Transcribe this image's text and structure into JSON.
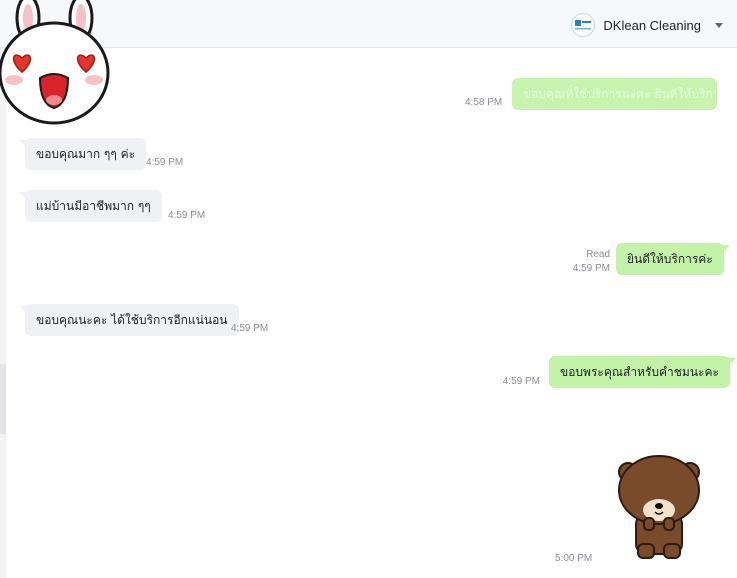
{
  "header": {
    "account_name": "DKlean Cleaning"
  },
  "messages": [
    {
      "side": "out",
      "text": "ขอบคุณที่ใช้บริการนะคะ ยินดีให้บริการค่ะ",
      "time": "4:58 PM"
    },
    {
      "side": "in",
      "text": "ขอบคุณมาก ๆๆ ค่ะ",
      "time": "4:59 PM"
    },
    {
      "side": "in",
      "text": "แม่บ้านมีอาชีพมาก ๆๆ",
      "time": "4:59 PM"
    },
    {
      "side": "out",
      "text": "ยินดีให้บริการค่ะ",
      "time": "4:59 PM",
      "status": "Read"
    },
    {
      "side": "in",
      "text": "ขอบคุณนะคะ ได้ใช้บริการอีกแน่นอน",
      "time": "4:59 PM"
    },
    {
      "side": "out",
      "text": "ขอบพระคุณสำหรับคำชมนะคะ",
      "time": "4:59 PM"
    },
    {
      "side": "out",
      "type": "sticker",
      "sticker": "brown-bear-bow",
      "time": "5:00 PM"
    }
  ],
  "stickers": {
    "top_left": "cony-heart-eyes-icon",
    "bottom_right": "brown-bear-icon"
  },
  "colors": {
    "outgoing_bubble": "#c3f3a9",
    "incoming_bubble": "#eff1f4",
    "header_bg": "#f7f8fa"
  }
}
